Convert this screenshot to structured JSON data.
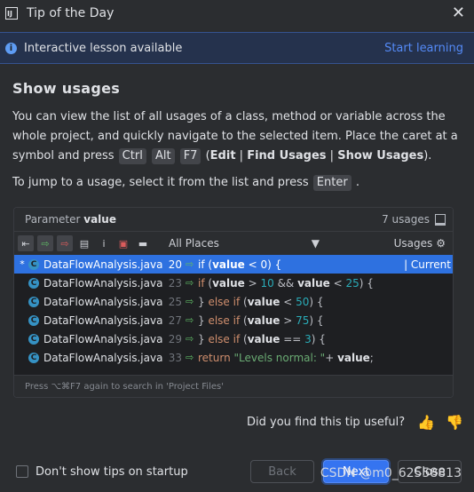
{
  "titlebar": {
    "title": "Tip of the Day",
    "app_icon": "intellij-logo-icon",
    "close_icon": "close-icon"
  },
  "banner": {
    "message": "Interactive lesson available",
    "link": "Start learning"
  },
  "heading": "Show usages",
  "para1": {
    "text1": "You can view the list of all usages of a class, method or variable across the whole project, and quickly navigate to the selected item. Place the caret at a symbol and press",
    "key1": "Ctrl",
    "key2": "Alt",
    "key3": "F7",
    "open": " (",
    "edit": "Edit",
    "sep": " | ",
    "find": "Find Usages",
    "show": "Show Usages",
    "close": ")."
  },
  "para2": {
    "text": "To jump to a usage, select it from the list and press",
    "key": "Enter",
    "end": "."
  },
  "popup": {
    "title_prefix": "Parameter ",
    "title_name": "value",
    "count": "7 usages",
    "scope": "All Places",
    "usages_label": "Usages",
    "footer": "Press ⌥⌘F7 again to search in 'Project Files'",
    "rows": [
      {
        "star": "*",
        "file": "DataFlowAnalysis.java",
        "line": "20",
        "current": "| Current"
      },
      {
        "file": "DataFlowAnalysis.java",
        "line": "23"
      },
      {
        "file": "DataFlowAnalysis.java",
        "line": "25"
      },
      {
        "file": "DataFlowAnalysis.java",
        "line": "27"
      },
      {
        "file": "DataFlowAnalysis.java",
        "line": "29"
      },
      {
        "file": "DataFlowAnalysis.java",
        "line": "33"
      }
    ],
    "code": {
      "r0": {
        "kw": "if",
        "a": " (",
        "v": "value",
        "b": " < ",
        "n": "0",
        "c": ") {"
      },
      "r1": {
        "kw": "if",
        "a": " (",
        "v": "value",
        "b": " > ",
        "n": "10",
        "c": " && ",
        "v2": "value",
        "d": " < ",
        "n2": "25",
        "e": ") {"
      },
      "r2": {
        "pre": "} ",
        "kw": "else if",
        "a": " (",
        "v": "value",
        "b": " < ",
        "n": "50",
        "c": ") {"
      },
      "r3": {
        "pre": "} ",
        "kw": "else if",
        "a": " (",
        "v": "value",
        "b": " > ",
        "n": "75",
        "c": ") {"
      },
      "r4": {
        "pre": "} ",
        "kw": "else if",
        "a": " (",
        "v": "value",
        "b": " == ",
        "n": "3",
        "c": ") {"
      },
      "r5": {
        "kw": "return",
        "s": " \"Levels normal: \"",
        "b": "+ ",
        "v": "value",
        "c": ";"
      }
    }
  },
  "feedback": {
    "question": "Did you find this tip useful?"
  },
  "footer": {
    "checkbox_label": "Don't show tips on startup",
    "back": "Back",
    "next": "Next",
    "close": "Close"
  },
  "watermark": "CSDN @m0_62558813",
  "colors": {
    "accent": "#3574f0",
    "selection": "#2e71e0",
    "background": "#2b2d30",
    "link": "#548af7"
  }
}
